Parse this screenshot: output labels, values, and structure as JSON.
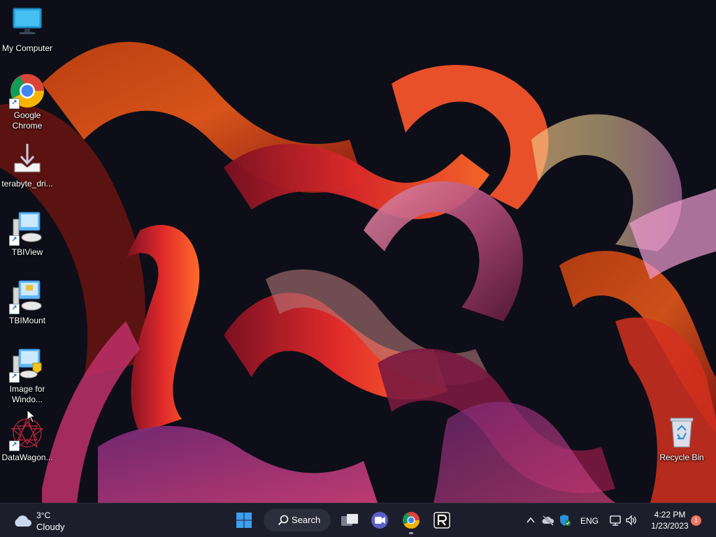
{
  "desktop": {
    "icons": [
      {
        "label": "My Computer",
        "icon": "monitor-icon",
        "shortcut": false
      },
      {
        "label": "Google Chrome",
        "icon": "chrome-icon",
        "shortcut": true
      },
      {
        "label": "terabyte_dri...",
        "icon": "download-tray-icon",
        "shortcut": false
      },
      {
        "label": "TBIView",
        "icon": "tbiview-icon",
        "shortcut": true
      },
      {
        "label": "TBIMount",
        "icon": "tbimount-icon",
        "shortcut": true
      },
      {
        "label": "Image for Windo...",
        "icon": "image-for-windows-icon",
        "shortcut": true
      },
      {
        "label": "DataWagon...",
        "icon": "datawagon-icon",
        "shortcut": true
      },
      {
        "label": "Recycle Bin",
        "icon": "recycle-bin-icon",
        "shortcut": false
      }
    ]
  },
  "taskbar": {
    "weather": {
      "temp": "3°C",
      "condition": "Cloudy",
      "icon": "cloud-icon"
    },
    "search_label": "Search",
    "pinned": [
      {
        "name": "start",
        "icon": "windows-logo-icon"
      },
      {
        "name": "task-view",
        "icon": "task-view-icon"
      },
      {
        "name": "teams-meet",
        "icon": "video-camera-icon"
      },
      {
        "name": "chrome",
        "icon": "chrome-icon"
      },
      {
        "name": "r-app",
        "icon": "r-app-icon"
      }
    ],
    "tray": {
      "language": "ENG",
      "time": "4:22 PM",
      "date": "1/23/2023",
      "notification_count": "1"
    }
  },
  "colors": {
    "taskbar_bg": "#1c1f2b",
    "desktop_bg": "#0d0e18",
    "accent_windows": "#3c9ff0",
    "badge": "#f0735f"
  }
}
